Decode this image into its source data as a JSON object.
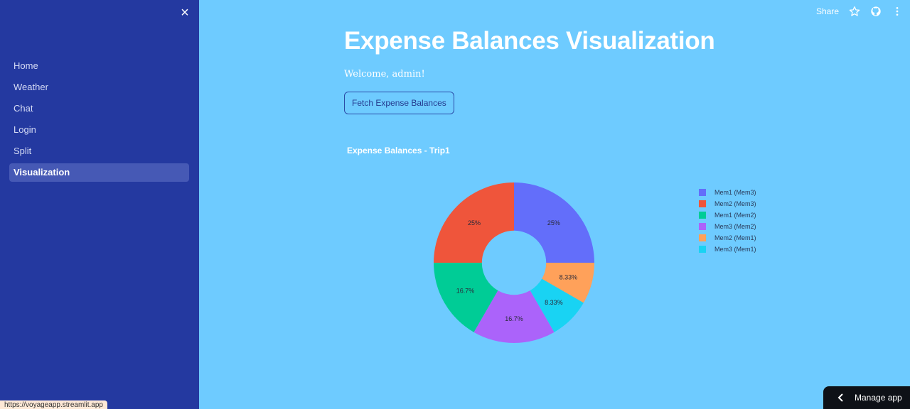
{
  "sidebar": {
    "close_label": "×",
    "items": [
      {
        "label": "Home",
        "active": false
      },
      {
        "label": "Weather",
        "active": false
      },
      {
        "label": "Chat",
        "active": false
      },
      {
        "label": "Login",
        "active": false
      },
      {
        "label": "Split",
        "active": false
      },
      {
        "label": "Visualization",
        "active": true
      }
    ]
  },
  "toolbar": {
    "share_label": "Share",
    "icons": [
      "star-icon",
      "github-icon",
      "more-vertical-icon"
    ]
  },
  "main": {
    "title": "Expense Balances Visualization",
    "welcome": "Welcome, admin!",
    "fetch_button_label": "Fetch Expense Balances"
  },
  "chart_data": {
    "type": "pie",
    "hole": 0.4,
    "title": "Expense Balances - Trip1",
    "legend_position": "right",
    "slices": [
      {
        "label": "Mem1 (Mem3)",
        "value": 3,
        "percent_text": "25%",
        "color": "#636efa"
      },
      {
        "label": "Mem2 (Mem3)",
        "value": 3,
        "percent_text": "25%",
        "color": "#ef553b"
      },
      {
        "label": "Mem1 (Mem2)",
        "value": 2,
        "percent_text": "16.7%",
        "color": "#00cc96"
      },
      {
        "label": "Mem3 (Mem2)",
        "value": 2,
        "percent_text": "16.7%",
        "color": "#ab63fa"
      },
      {
        "label": "Mem2 (Mem1)",
        "value": 1,
        "percent_text": "8.33%",
        "color": "#ffa15a"
      },
      {
        "label": "Mem3 (Mem1)",
        "value": 1,
        "percent_text": "8.33%",
        "color": "#19d3f3"
      }
    ],
    "slice_order_drawn": [
      0,
      4,
      5,
      3,
      2,
      1
    ]
  },
  "status_url": "https://voyageapp.streamlit.app",
  "manage_app_label": "Manage app"
}
